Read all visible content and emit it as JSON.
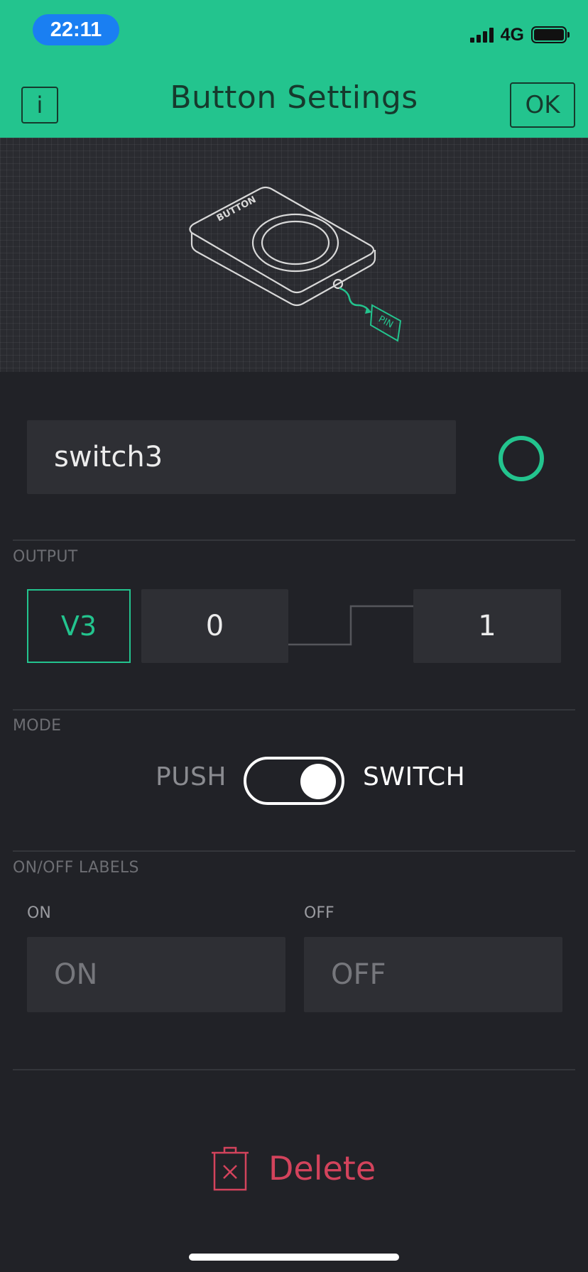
{
  "status_bar": {
    "time": "22:11",
    "network": "4G"
  },
  "header": {
    "info_label": "i",
    "title": "Button Settings",
    "ok_label": "OK"
  },
  "illustration": {
    "device_label": "BUTTON",
    "pin_label": "PIN"
  },
  "widget": {
    "name_value": "switch3",
    "color": "#23c48e"
  },
  "output": {
    "section_label": "OUTPUT",
    "pin": "V3",
    "low_value": "0",
    "high_value": "1"
  },
  "mode": {
    "section_label": "MODE",
    "left_label": "PUSH",
    "right_label": "SWITCH",
    "selected": "SWITCH"
  },
  "labels": {
    "section_label": "ON/OFF LABELS",
    "on_caption": "ON",
    "on_placeholder": "ON",
    "off_caption": "OFF",
    "off_placeholder": "OFF"
  },
  "actions": {
    "delete_label": "Delete"
  },
  "colors": {
    "accent": "#23c48e",
    "background": "#212227",
    "danger": "#d3435c",
    "status_time_pill": "#1a7ff2"
  }
}
